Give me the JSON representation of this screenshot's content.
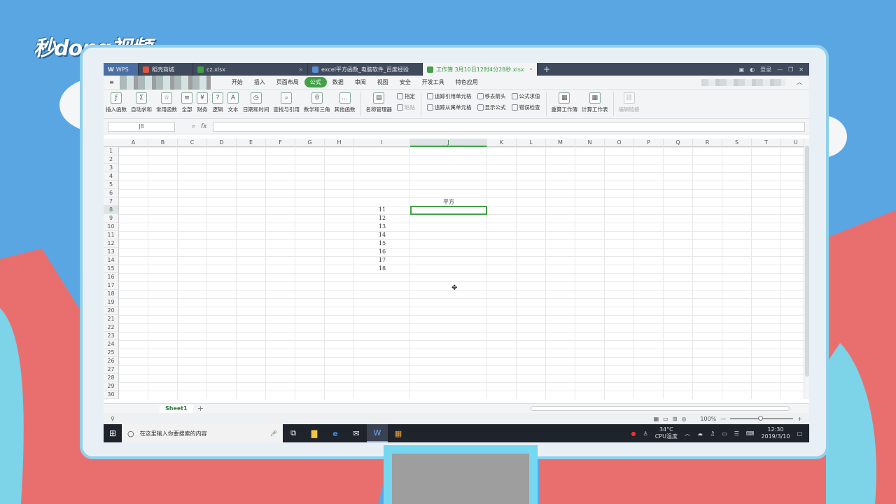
{
  "branding": {
    "logo_text": "秒dong视频"
  },
  "tabs": [
    {
      "label": "WPS",
      "icon": "wps-icon"
    },
    {
      "label": "稻壳商城",
      "icon": "docer-icon"
    },
    {
      "label": "cz.xlsx",
      "icon": "excel-icon"
    },
    {
      "label": "excel平方函数_电脑软件_百度经验",
      "icon": "browser-icon"
    },
    {
      "label": "工作簿 3月10日12时4分28秒.xlsx",
      "icon": "excel-icon",
      "active": true
    }
  ],
  "tab_right": {
    "user_label": "登录"
  },
  "menu": [
    "开始",
    "插入",
    "页面布局",
    "公式",
    "数据",
    "审阅",
    "视图",
    "安全",
    "开发工具",
    "特色应用"
  ],
  "menu_active": "公式",
  "ribbon": {
    "insert_function": "插入函数",
    "autosum": "自动求和",
    "common_functions": "常用函数",
    "all": "全部",
    "finance": "财务",
    "logic": "逻辑",
    "text": "文本",
    "datetime": "日期和时间",
    "lookup": "查找与引用",
    "math": "数学和三角",
    "other": "其他函数",
    "name_manager": "名称管理器",
    "define": "指定",
    "paste": "粘贴",
    "trace_precedents": "追踪引用单元格",
    "trace_dependents": "追踪从属单元格",
    "remove_arrows": "移去箭头",
    "show_formula": "显示公式",
    "formula_eval": "公式求值",
    "error_check": "错误检查",
    "recalc_book": "重算工作簿",
    "calc_sheet": "计算工作表",
    "edit_links": "编辑链接"
  },
  "formula_bar": {
    "cell_ref": "J8",
    "fx": "fx",
    "value": ""
  },
  "columns": [
    "A",
    "B",
    "C",
    "D",
    "E",
    "F",
    "G",
    "H",
    "I",
    "J",
    "K",
    "L",
    "M",
    "N",
    "O",
    "P",
    "Q",
    "R",
    "S",
    "T",
    "U"
  ],
  "rows": [
    "1",
    "2",
    "3",
    "4",
    "5",
    "6",
    "7",
    "8",
    "9",
    "10",
    "11",
    "12",
    "13",
    "14",
    "15",
    "16",
    "17",
    "18",
    "19",
    "20",
    "21",
    "22",
    "23",
    "24",
    "25",
    "26",
    "27",
    "28",
    "29",
    "30"
  ],
  "cells": {
    "J7": "平方",
    "I8": "11",
    "I9": "12",
    "I10": "13",
    "I11": "14",
    "I12": "15",
    "I13": "16",
    "I14": "17",
    "I15": "18"
  },
  "selected_cell": "J8",
  "sheet_tab": "Sheet1",
  "status": {
    "zoom": "100%"
  },
  "taskbar": {
    "search_placeholder": "在这里输入你要搜索的内容",
    "temp": "34°C",
    "temp_label": "CPU温度",
    "time": "12:30",
    "date": "2019/3/10"
  },
  "colors": {
    "accent": "#43a047",
    "tabbar": "#3f4a5c",
    "taskbar": "#1f232b"
  }
}
